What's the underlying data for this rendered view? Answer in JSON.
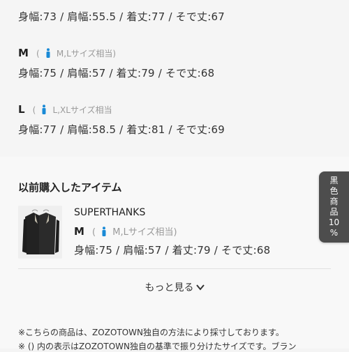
{
  "colors": {
    "accent_icon": "#1a8ad6",
    "side_tab_bg": "#4d4d4d"
  },
  "size_list": {
    "row_s": {
      "measurements": "身幅:73 / 肩幅:55.5 / 着丈:77 / そで丈:67"
    },
    "row_m": {
      "size": "M",
      "paren_open": "(",
      "fit": "M,Lサイズ相当)",
      "icon": "person-icon",
      "measurements": "身幅:75 / 肩幅:57 / 着丈:79 / そで丈:68"
    },
    "row_l": {
      "size": "L",
      "paren_open": "(",
      "fit": "L,XLサイズ相当",
      "icon": "person-icon",
      "measurements": "身幅:77 / 肩幅:58.5 / 着丈:81 / そで丈:69"
    }
  },
  "purchased": {
    "heading": "以前購入したアイテム",
    "item": {
      "brand": "SUPERTHANKS",
      "size": "M",
      "paren_open": "(",
      "fit": "M,Lサイズ相当)",
      "measurements": "身幅:75 / 肩幅:57 / 着丈:79 / そで丈:68"
    },
    "more_label": "もっと見る"
  },
  "notes": {
    "line1": "※こちらの商品は、ZOZOTOWN独自の方法により採寸しております。",
    "line2": "※ () 内の表示はZOZOTOWN独自の基準で振り分けたサイズです。ブラン"
  },
  "side_tab": {
    "chars": [
      "黒",
      "色",
      "商",
      "品",
      "10",
      "%"
    ]
  }
}
